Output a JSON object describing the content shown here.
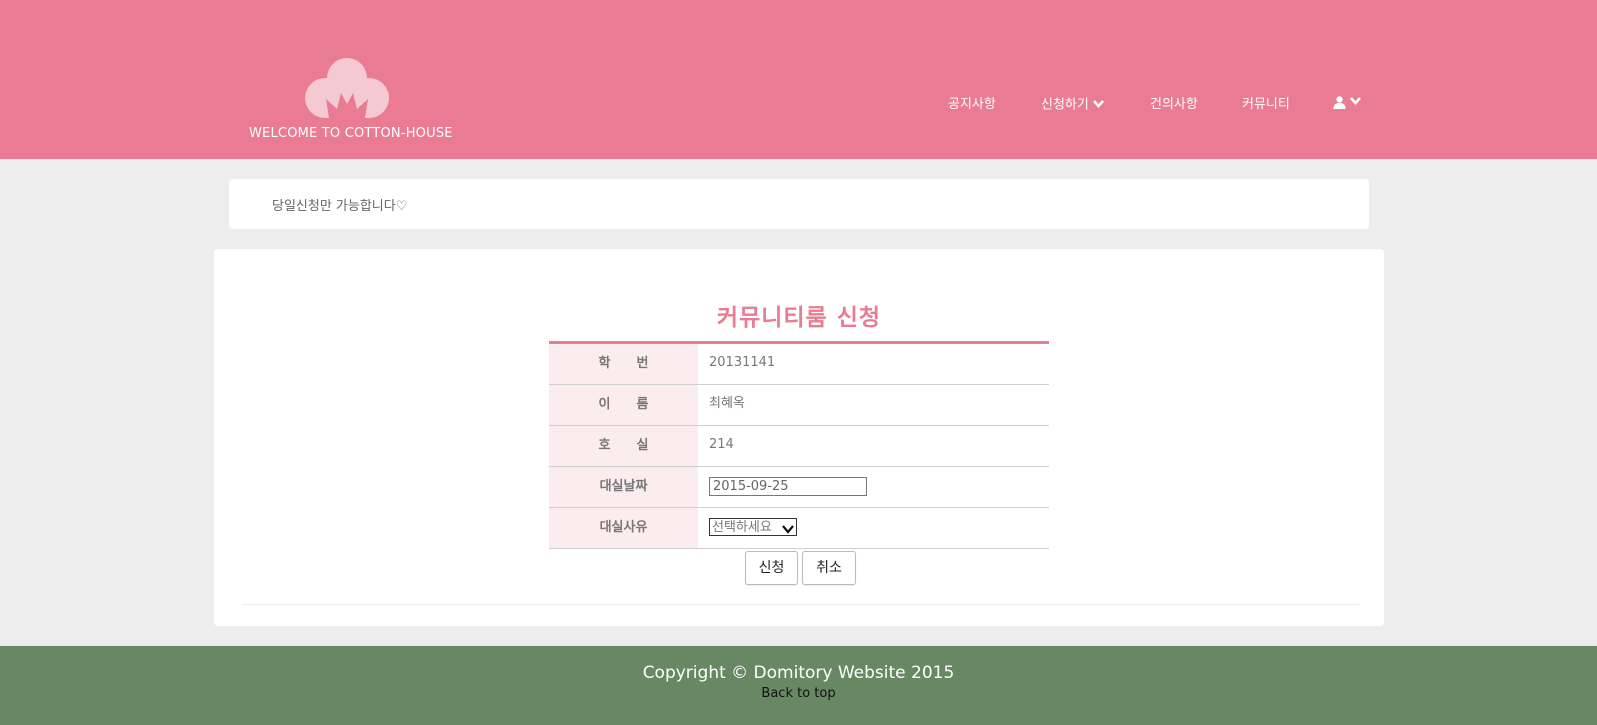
{
  "header": {
    "logo_text": "WELCOME TO COTTON-HOUSE",
    "brand_color": "#e97b92",
    "nav": [
      {
        "label": "공지사항",
        "icon": null
      },
      {
        "label": "신청하기",
        "icon": "chevron-down-icon"
      },
      {
        "label": "건의사항",
        "icon": null
      },
      {
        "label": "커뮤니티",
        "icon": null
      },
      {
        "label": "",
        "icon": "user-icon"
      }
    ]
  },
  "notice": {
    "text": "당일신청만 가능합니다♡"
  },
  "form": {
    "title": "커뮤니티룸 신청",
    "rows": [
      {
        "label": "학　　번",
        "value": "20131141"
      },
      {
        "label": "이　　름",
        "value": "최혜옥"
      },
      {
        "label": "호　　실",
        "value": "214"
      },
      {
        "label": "대실날짜",
        "value": "2015-09-25"
      },
      {
        "label": "대실사유",
        "value": "선택하세요"
      }
    ],
    "submit_label": "신청",
    "cancel_label": "취소"
  },
  "footer": {
    "copyright": "Copyright © Domitory Website 2015",
    "back_to_top": "Back to top",
    "color": "#678863"
  }
}
